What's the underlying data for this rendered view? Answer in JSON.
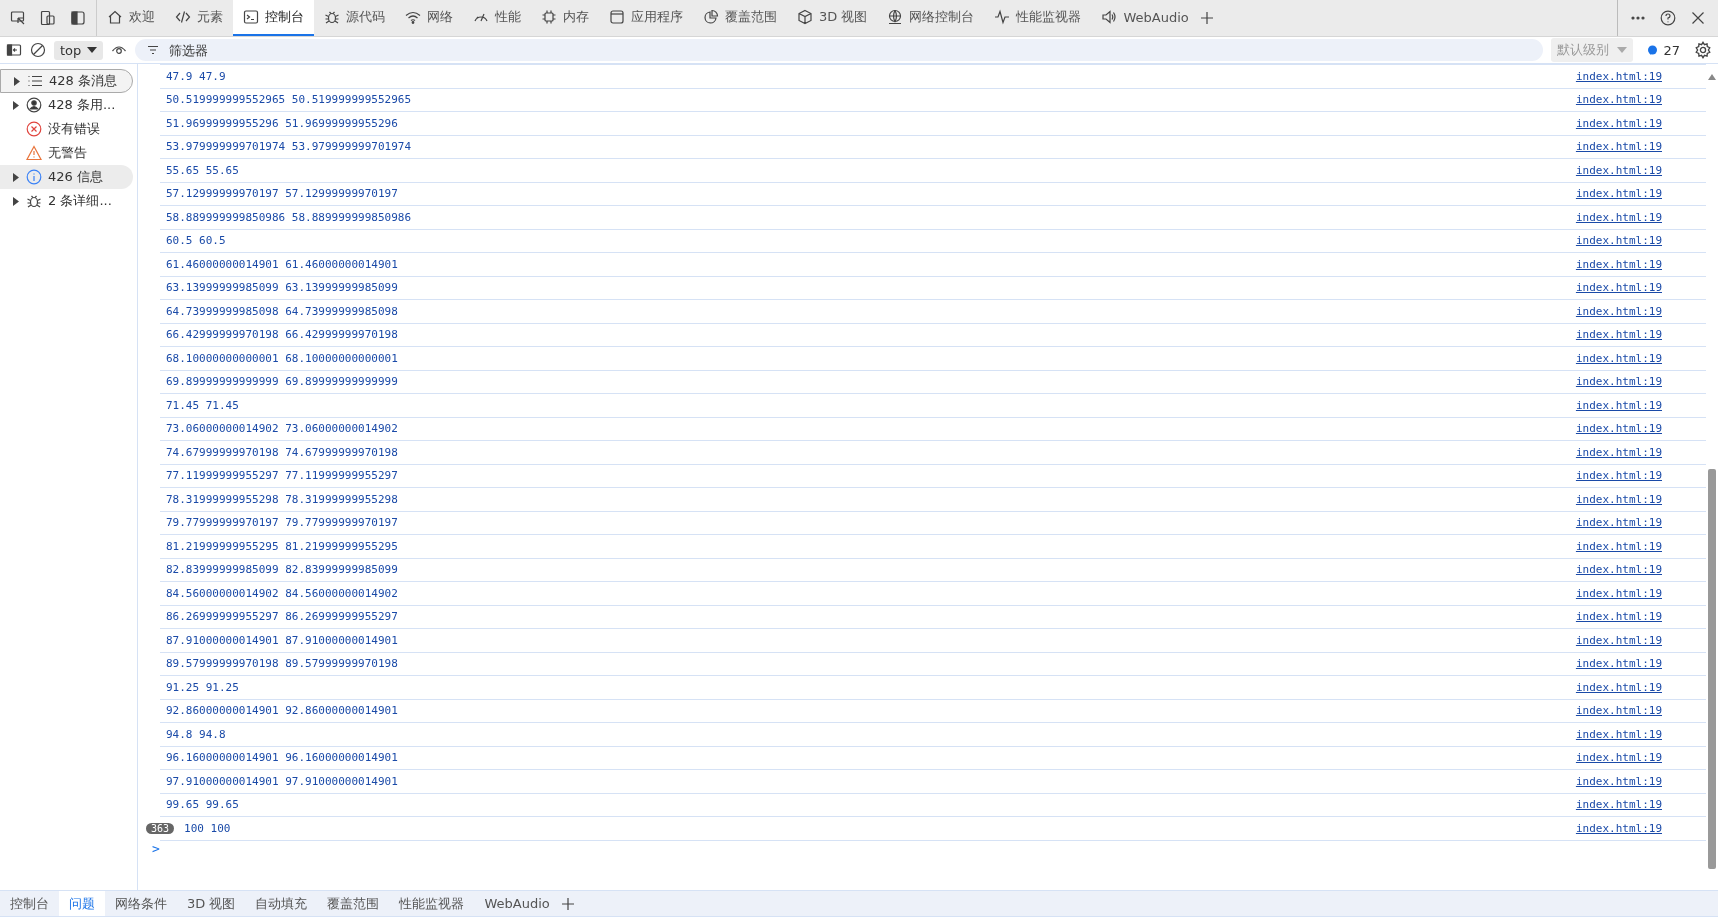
{
  "main_tabs": [
    {
      "label": "欢迎",
      "selected": false
    },
    {
      "label": "元素",
      "selected": false
    },
    {
      "label": "控制台",
      "selected": true
    },
    {
      "label": "源代码",
      "selected": false
    },
    {
      "label": "网络",
      "selected": false
    },
    {
      "label": "性能",
      "selected": false
    },
    {
      "label": "内存",
      "selected": false
    },
    {
      "label": "应用程序",
      "selected": false
    },
    {
      "label": "覆盖范围",
      "selected": false
    },
    {
      "label": "3D 视图",
      "selected": false
    },
    {
      "label": "网络控制台",
      "selected": false
    },
    {
      "label": "性能监视器",
      "selected": false
    },
    {
      "label": "WebAudio",
      "selected": false
    }
  ],
  "filter_bar": {
    "context": "top",
    "placeholder": "筛选器",
    "level": "默认级别",
    "issues_count": "27"
  },
  "sidebar": {
    "items": [
      {
        "label": "428 条消息",
        "expandable": true,
        "selected": true,
        "hovered": false
      },
      {
        "label": "428 条用...",
        "expandable": true,
        "selected": false,
        "hovered": false
      },
      {
        "label": "没有错误",
        "expandable": false,
        "selected": false,
        "hovered": false
      },
      {
        "label": "无警告",
        "expandable": false,
        "selected": false,
        "hovered": false
      },
      {
        "label": "426 信息",
        "expandable": true,
        "selected": false,
        "hovered": true
      },
      {
        "label": "2 条详细...",
        "expandable": true,
        "selected": false,
        "hovered": false
      }
    ]
  },
  "console": {
    "messages": [
      {
        "text": "47.9 47.9",
        "source": "index.html:19"
      },
      {
        "text": "50.519999999552965 50.519999999552965",
        "source": "index.html:19"
      },
      {
        "text": "51.96999999955296 51.96999999955296",
        "source": "index.html:19"
      },
      {
        "text": "53.979999999701974 53.979999999701974",
        "source": "index.html:19"
      },
      {
        "text": "55.65 55.65",
        "source": "index.html:19"
      },
      {
        "text": "57.12999999970197 57.12999999970197",
        "source": "index.html:19"
      },
      {
        "text": "58.889999999850986 58.889999999850986",
        "source": "index.html:19"
      },
      {
        "text": "60.5 60.5",
        "source": "index.html:19"
      },
      {
        "text": "61.46000000014901 61.46000000014901",
        "source": "index.html:19"
      },
      {
        "text": "63.13999999985099 63.13999999985099",
        "source": "index.html:19"
      },
      {
        "text": "64.73999999985098 64.73999999985098",
        "source": "index.html:19"
      },
      {
        "text": "66.42999999970198 66.42999999970198",
        "source": "index.html:19"
      },
      {
        "text": "68.10000000000001 68.10000000000001",
        "source": "index.html:19"
      },
      {
        "text": "69.89999999999999 69.89999999999999",
        "source": "index.html:19"
      },
      {
        "text": "71.45 71.45",
        "source": "index.html:19"
      },
      {
        "text": "73.06000000014902 73.06000000014902",
        "source": "index.html:19"
      },
      {
        "text": "74.67999999970198 74.67999999970198",
        "source": "index.html:19"
      },
      {
        "text": "77.11999999955297 77.11999999955297",
        "source": "index.html:19"
      },
      {
        "text": "78.31999999955298 78.31999999955298",
        "source": "index.html:19"
      },
      {
        "text": "79.77999999970197 79.77999999970197",
        "source": "index.html:19"
      },
      {
        "text": "81.21999999955295 81.21999999955295",
        "source": "index.html:19"
      },
      {
        "text": "82.83999999985099 82.83999999985099",
        "source": "index.html:19"
      },
      {
        "text": "84.56000000014902 84.56000000014902",
        "source": "index.html:19"
      },
      {
        "text": "86.26999999955297 86.26999999955297",
        "source": "index.html:19"
      },
      {
        "text": "87.91000000014901 87.91000000014901",
        "source": "index.html:19"
      },
      {
        "text": "89.57999999970198 89.57999999970198",
        "source": "index.html:19"
      },
      {
        "text": "91.25 91.25",
        "source": "index.html:19"
      },
      {
        "text": "92.86000000014901 92.86000000014901",
        "source": "index.html:19"
      },
      {
        "text": "94.8 94.8",
        "source": "index.html:19"
      },
      {
        "text": "96.16000000014901 96.16000000014901",
        "source": "index.html:19"
      },
      {
        "text": "97.91000000014901 97.91000000014901",
        "source": "index.html:19"
      },
      {
        "text": "99.65 99.65",
        "source": "index.html:19"
      },
      {
        "repeat": "363",
        "text": "100 100",
        "source": "index.html:19"
      }
    ],
    "prompt": ">"
  },
  "drawer_tabs": [
    {
      "label": "控制台",
      "selected": false
    },
    {
      "label": "问题",
      "selected": true
    },
    {
      "label": "网络条件",
      "selected": false
    },
    {
      "label": "3D 视图",
      "selected": false
    },
    {
      "label": "自动填充",
      "selected": false
    },
    {
      "label": "覆盖范围",
      "selected": false
    },
    {
      "label": "性能监视器",
      "selected": false
    },
    {
      "label": "WebAudio",
      "selected": false
    }
  ]
}
